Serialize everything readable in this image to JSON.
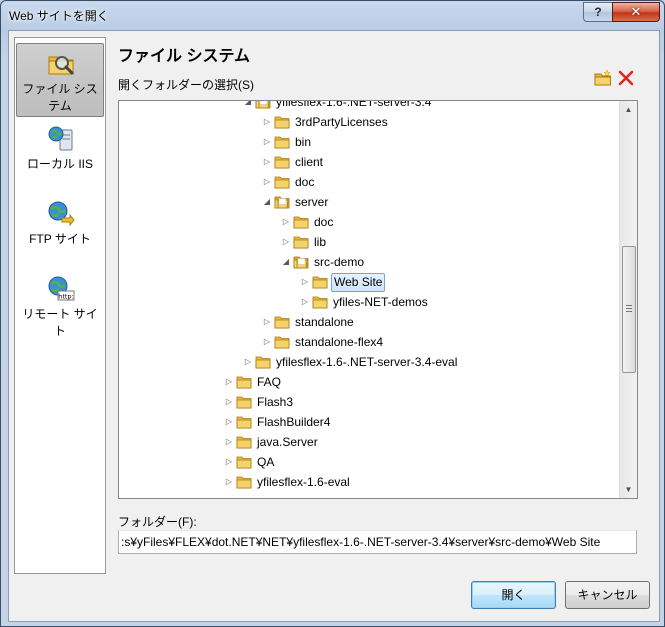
{
  "window": {
    "title": "Web サイトを開く",
    "help_label": "?",
    "close_label": "✕"
  },
  "places": [
    {
      "label": "ファイル システム",
      "icon": "file-system-icon",
      "selected": true
    },
    {
      "label": "ローカル IIS",
      "icon": "local-iis-icon",
      "selected": false
    },
    {
      "label": "FTP サイト",
      "icon": "ftp-site-icon",
      "selected": false
    },
    {
      "label": "リモート サイト",
      "icon": "remote-site-icon",
      "selected": false
    }
  ],
  "header": {
    "title": "ファイル システム",
    "select_label": "開くフォルダーの選択(S)",
    "new_folder_icon": "new-folder-icon",
    "delete_icon": "delete-icon"
  },
  "tree": [
    {
      "label": "yfilesflex-1.6-.NET-server-3.4",
      "level": 2,
      "expanded": true
    },
    {
      "label": "3rdPartyLicenses",
      "level": 3,
      "expanded": false
    },
    {
      "label": "bin",
      "level": 3,
      "expanded": false
    },
    {
      "label": "client",
      "level": 3,
      "expanded": false
    },
    {
      "label": "doc",
      "level": 3,
      "expanded": false
    },
    {
      "label": "server",
      "level": 3,
      "expanded": true
    },
    {
      "label": "doc",
      "level": 4,
      "expanded": false
    },
    {
      "label": "lib",
      "level": 4,
      "expanded": false
    },
    {
      "label": "src-demo",
      "level": 4,
      "expanded": true
    },
    {
      "label": "Web Site",
      "level": 5,
      "expanded": false,
      "selected": true
    },
    {
      "label": "yfiles-NET-demos",
      "level": 5,
      "expanded": false
    },
    {
      "label": "standalone",
      "level": 3,
      "expanded": false
    },
    {
      "label": "standalone-flex4",
      "level": 3,
      "expanded": false
    },
    {
      "label": "yfilesflex-1.6-.NET-server-3.4-eval",
      "level": 2,
      "expanded": false
    },
    {
      "label": "FAQ",
      "level": 1,
      "expanded": false
    },
    {
      "label": "Flash3",
      "level": 1,
      "expanded": false
    },
    {
      "label": "FlashBuilder4",
      "level": 1,
      "expanded": false
    },
    {
      "label": "java.Server",
      "level": 1,
      "expanded": false
    },
    {
      "label": "QA",
      "level": 1,
      "expanded": false
    },
    {
      "label": "yfilesflex-1.6-eval",
      "level": 1,
      "expanded": false
    }
  ],
  "folder": {
    "label": "フォルダー(F):",
    "value": ":s¥yFiles¥FLEX¥dot.NET¥NET¥yfilesflex-1.6-.NET-server-3.4¥server¥src-demo¥Web Site"
  },
  "buttons": {
    "open_label": "開く",
    "cancel_label": "キャンセル"
  },
  "colors": {
    "frame": "#c4d3e6",
    "selection": "#d0e4fa",
    "close_button": "#c2361c",
    "folder": "#e8b93d"
  }
}
